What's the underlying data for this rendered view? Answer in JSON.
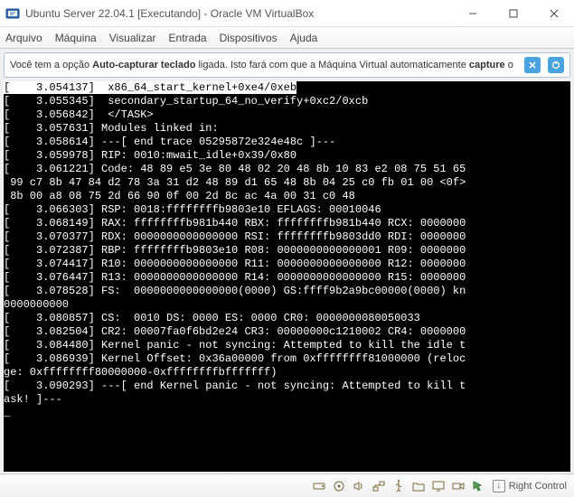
{
  "window": {
    "title": "Ubuntu Server 22.04.1 [Executando] - Oracle VM VirtualBox"
  },
  "menu": {
    "items": [
      "Arquivo",
      "Máquina",
      "Visualizar",
      "Entrada",
      "Dispositivos",
      "Ajuda"
    ]
  },
  "notice": {
    "pre": "Você tem a opção ",
    "bold1": "Auto-capturar teclado",
    "mid": " ligada. Isto fará com que a Máquina Virtual automaticamente ",
    "bold2": "capture",
    "post": " o"
  },
  "terminal_lines": [
    {
      "hl": true,
      "text": "[    3.054137]  x86_64_start_kernel+0xe4/0xeb"
    },
    {
      "hl": false,
      "text": "[    3.055345]  secondary_startup_64_no_verify+0xc2/0xcb"
    },
    {
      "hl": false,
      "text": "[    3.056842]  </TASK>"
    },
    {
      "hl": false,
      "text": "[    3.057631] Modules linked in:"
    },
    {
      "hl": false,
      "text": "[    3.058614] ---[ end trace 05295872e324e48c ]---"
    },
    {
      "hl": false,
      "text": "[    3.059978] RIP: 0010:mwait_idle+0x39/0x80"
    },
    {
      "hl": false,
      "text": "[    3.061221] Code: 48 89 e5 3e 80 48 02 20 48 8b 10 83 e2 08 75 51 65 "
    },
    {
      "hl": false,
      "text": " 99 c7 8b 47 84 d2 78 3a 31 d2 48 89 d1 65 48 8b 04 25 c0 fb 01 00 <0f>"
    },
    {
      "hl": false,
      "text": " 8b 00 a8 08 75 2d 66 90 0f 00 2d 8c ac 4a 00 31 c0 48"
    },
    {
      "hl": false,
      "text": "[    3.066303] RSP: 0018:ffffffffb9803e10 EFLAGS: 00010046"
    },
    {
      "hl": false,
      "text": "[    3.068149] RAX: ffffffffb981b440 RBX: ffffffffb981b440 RCX: 0000000"
    },
    {
      "hl": false,
      "text": "[    3.070377] RDX: 0000000000000000 RSI: ffffffffb9803dd0 RDI: 0000000"
    },
    {
      "hl": false,
      "text": "[    3.072387] RBP: ffffffffb9803e10 R08: 0000000000000001 R09: 0000000"
    },
    {
      "hl": false,
      "text": "[    3.074417] R10: 0000000000000000 R11: 0000000000000000 R12: 0000000"
    },
    {
      "hl": false,
      "text": "[    3.076447] R13: 0000000000000000 R14: 0000000000000000 R15: 0000000"
    },
    {
      "hl": false,
      "text": "[    3.078528] FS:  0000000000000000(0000) GS:ffff9b2a9bc00000(0000) kn"
    },
    {
      "hl": false,
      "text": "0000000000"
    },
    {
      "hl": false,
      "text": "[    3.080857] CS:  0010 DS: 0000 ES: 0000 CR0: 0000000080050033"
    },
    {
      "hl": false,
      "text": "[    3.082504] CR2: 00007fa0f6bd2e24 CR3: 00000000c1210002 CR4: 0000000"
    },
    {
      "hl": false,
      "text": "[    3.084480] Kernel panic - not syncing: Attempted to kill the idle t"
    },
    {
      "hl": false,
      "text": "[    3.086939] Kernel Offset: 0x36a00000 from 0xffffffff81000000 (reloc"
    },
    {
      "hl": false,
      "text": "ge: 0xffffffff80000000-0xffffffffbfffffff)"
    },
    {
      "hl": false,
      "text": "[    3.090293] ---[ end Kernel panic - not syncing: Attempted to kill t"
    },
    {
      "hl": false,
      "text": "ask! ]---"
    },
    {
      "hl": false,
      "text": "_"
    }
  ],
  "status": {
    "hostkey": "Right Control"
  }
}
